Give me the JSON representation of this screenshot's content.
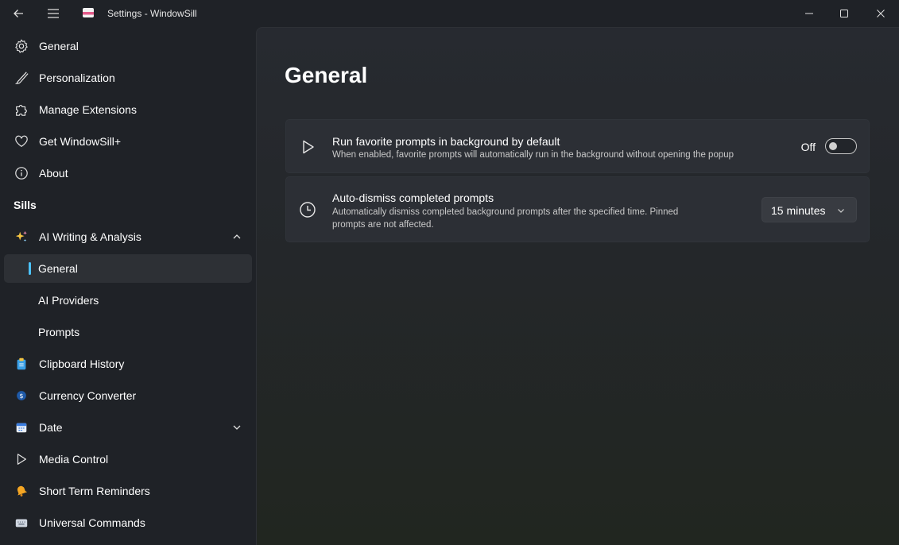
{
  "window": {
    "title": "Settings - WindowSill"
  },
  "sidebar": {
    "top_items": [
      {
        "label": "General",
        "icon": "gear-icon"
      },
      {
        "label": "Personalization",
        "icon": "brush-icon"
      },
      {
        "label": "Manage Extensions",
        "icon": "puzzle-icon"
      },
      {
        "label": "Get WindowSill+",
        "icon": "heart-icon"
      },
      {
        "label": "About",
        "icon": "info-icon"
      }
    ],
    "section_header": "Sills",
    "sills": [
      {
        "label": "AI Writing & Analysis",
        "icon": "sparkles-icon"
      },
      {
        "label": "General"
      },
      {
        "label": "AI Providers"
      },
      {
        "label": "Prompts"
      },
      {
        "label": "Clipboard History",
        "icon": "clipboard-icon"
      },
      {
        "label": "Currency Converter",
        "icon": "currency-icon"
      },
      {
        "label": "Date",
        "icon": "calendar-icon"
      },
      {
        "label": "Media Control",
        "icon": "play-icon"
      },
      {
        "label": "Short Term Reminders",
        "icon": "bell-icon"
      },
      {
        "label": "Universal Commands",
        "icon": "keyboard-icon"
      }
    ],
    "selected": "General (AI Writing & Analysis)"
  },
  "main": {
    "page_title": "General",
    "settings": [
      {
        "title": "Run favorite prompts in background by default",
        "description": "When enabled, favorite prompts will automatically run in the background without opening the popup",
        "control": "toggle",
        "state_label": "Off",
        "on": false,
        "icon": "play-icon"
      },
      {
        "title": "Auto-dismiss completed prompts",
        "description_line1": "Automatically dismiss completed background prompts after the specified time. Pinned",
        "description_line2": "prompts are not affected.",
        "control": "dropdown",
        "selected_value": "15 minutes",
        "icon": "clock-icon"
      }
    ]
  },
  "colors": {
    "accent": "#4cc2ff",
    "background": "#1f2227",
    "card": "#2c2f35"
  }
}
